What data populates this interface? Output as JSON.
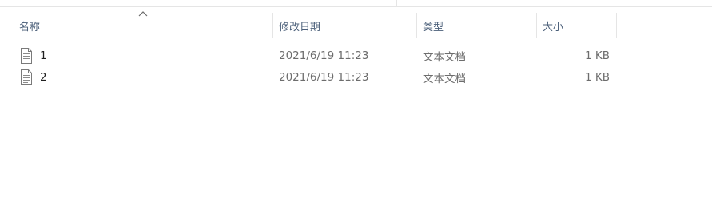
{
  "columns": {
    "name": "名称",
    "date": "修改日期",
    "type": "类型",
    "size": "大小"
  },
  "sort": {
    "column": "name",
    "direction": "ascending"
  },
  "files": [
    {
      "name": "1",
      "modified": "2021/6/19 11:23",
      "type": "文本文档",
      "size": "1 KB",
      "icon": "text-document-icon"
    },
    {
      "name": "2",
      "modified": "2021/6/19 11:23",
      "type": "文本文档",
      "size": "1 KB",
      "icon": "text-document-icon"
    }
  ]
}
